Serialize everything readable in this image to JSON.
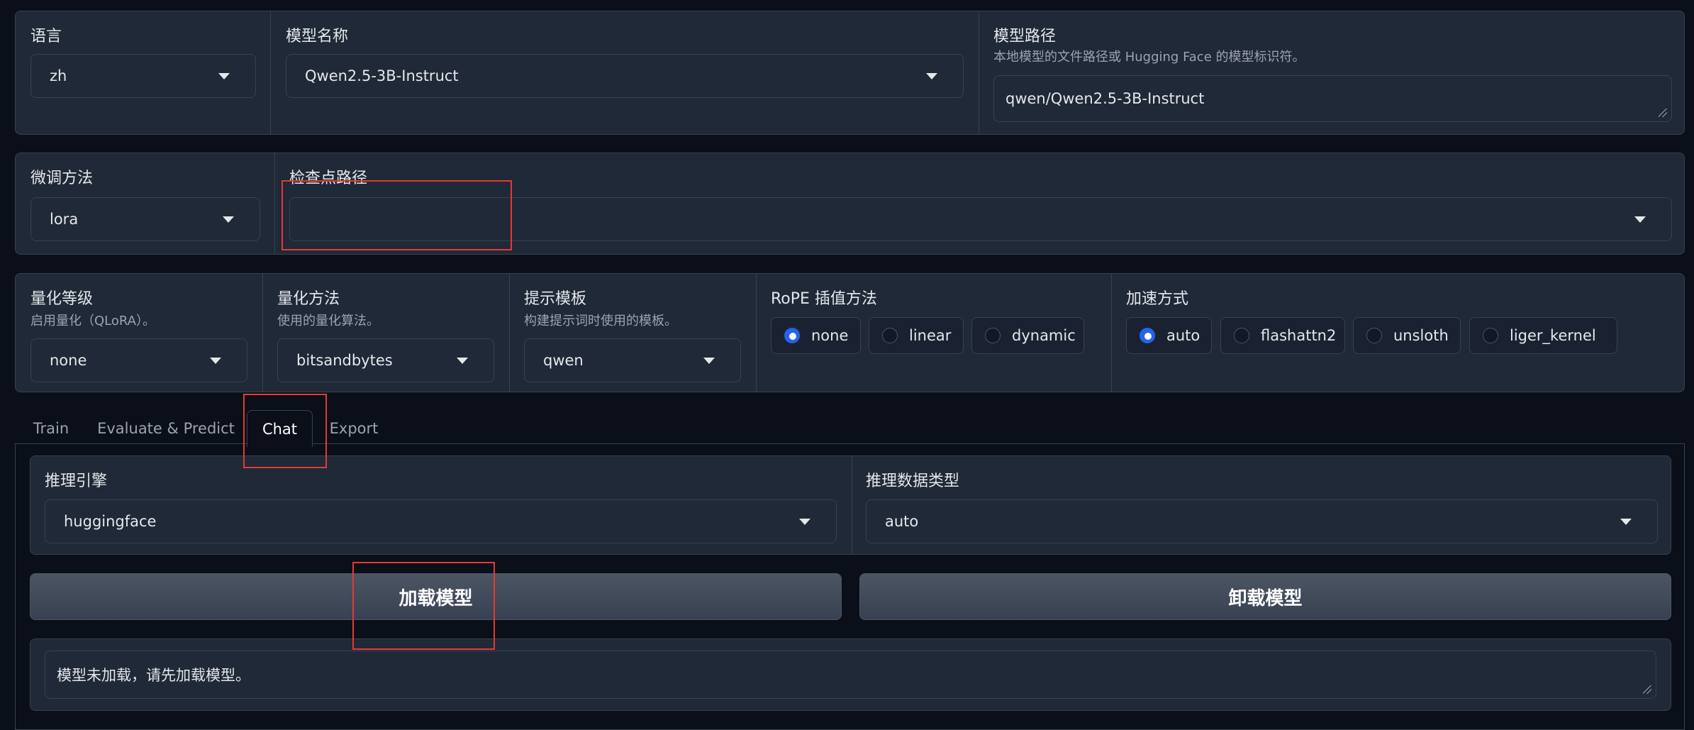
{
  "row1": {
    "lang": {
      "label": "语言",
      "value": "zh"
    },
    "model_name": {
      "label": "模型名称",
      "value": "Qwen2.5-3B-Instruct"
    },
    "model_path": {
      "label": "模型路径",
      "info": "本地模型的文件路径或 Hugging Face 的模型标识符。",
      "value": "qwen/Qwen2.5-3B-Instruct"
    }
  },
  "row2": {
    "finetune": {
      "label": "微调方法",
      "value": "lora"
    },
    "checkpoint": {
      "label": "检查点路径",
      "value": ""
    }
  },
  "row3": {
    "quant_bit": {
      "label": "量化等级",
      "info": "启用量化（QLoRA）。",
      "value": "none"
    },
    "quant_method": {
      "label": "量化方法",
      "info": "使用的量化算法。",
      "value": "bitsandbytes"
    },
    "template": {
      "label": "提示模板",
      "info": "构建提示词时使用的模板。",
      "value": "qwen"
    },
    "rope": {
      "label": "RoPE 插值方法",
      "options": [
        "none",
        "linear",
        "dynamic"
      ],
      "selected": "none"
    },
    "booster": {
      "label": "加速方式",
      "options": [
        "auto",
        "flashattn2",
        "unsloth",
        "liger_kernel"
      ],
      "selected": "auto"
    }
  },
  "tabs": [
    "Train",
    "Evaluate & Predict",
    "Chat",
    "Export"
  ],
  "active_tab": "Chat",
  "chat": {
    "infer_backend": {
      "label": "推理引擎",
      "value": "huggingface"
    },
    "infer_dtype": {
      "label": "推理数据类型",
      "value": "auto"
    },
    "load_button": "加载模型",
    "unload_button": "卸载模型",
    "info_box": "模型未加载，请先加载模型。"
  },
  "colors": {
    "background": "#0b0f19",
    "panel": "#1f2937",
    "border": "#374151",
    "accent": "#2563eb",
    "highlight": "#e53935"
  }
}
